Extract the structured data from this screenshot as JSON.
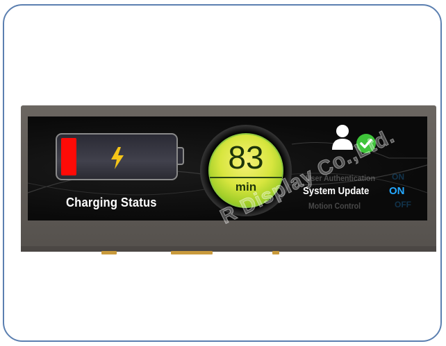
{
  "battery": {
    "label": "Charging Status",
    "level_fraction": 0.14,
    "level_color": "#ff0b07"
  },
  "timer": {
    "value": "83",
    "unit": "min"
  },
  "settings": [
    {
      "label": "User Authentication",
      "value": "ON",
      "faded": true
    },
    {
      "label": "System Update",
      "value": "ON",
      "faded": false
    },
    {
      "label": "Motion Control",
      "value": "OFF",
      "faded": true
    }
  ],
  "icons": {
    "user": "user-icon",
    "check": "checkmark-icon",
    "bolt": "lightning-bolt-icon"
  },
  "watermark": "R Display Co.,Ltd.",
  "colors": {
    "frame": "#5b7fb0",
    "accent_blue": "#24a8ff",
    "gauge_green": "#86c21e",
    "check_green": "#3fc43a"
  }
}
